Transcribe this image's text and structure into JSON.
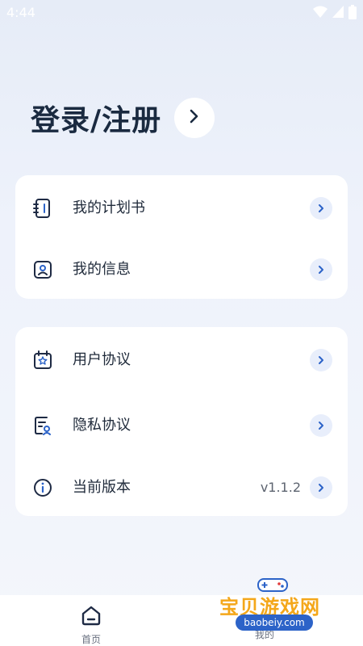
{
  "status_bar": {
    "time": "4:44"
  },
  "header": {
    "login_title": "登录/注册"
  },
  "menu_group_1": [
    {
      "label": "我的计划书",
      "icon": "planbook-icon"
    },
    {
      "label": "我的信息",
      "icon": "profile-card-icon"
    }
  ],
  "menu_group_2": [
    {
      "label": "用户协议",
      "icon": "user-agreement-icon"
    },
    {
      "label": "隐私协议",
      "icon": "privacy-policy-icon"
    },
    {
      "label": "当前版本",
      "value": "v1.1.2",
      "icon": "info-icon"
    }
  ],
  "bottom_nav": {
    "home_label": "首页",
    "mine_label": "我的"
  },
  "watermark": {
    "text": "宝贝游戏网",
    "url": "baobeiy.com"
  },
  "colors": {
    "accent": "#2c63c8",
    "title": "#1a2a40",
    "chevron_bg": "#e8eefb"
  }
}
